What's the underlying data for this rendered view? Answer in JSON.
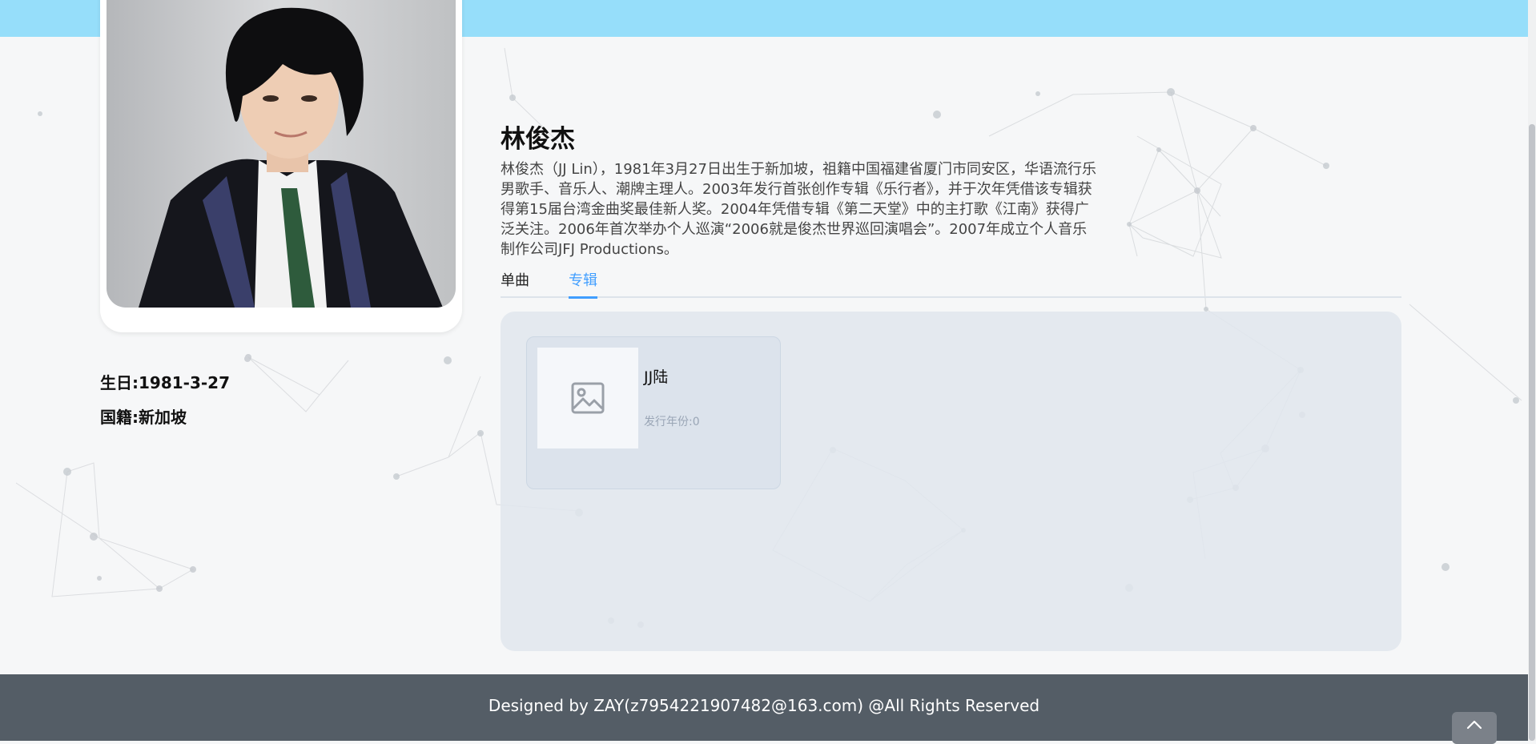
{
  "artist": {
    "name": "林俊杰",
    "bio": "林俊杰（JJ Lin），1981年3月27日出生于新加坡，祖籍中国福建省厦门市同安区，华语流行乐男歌手、音乐人、潮牌主理人。2003年发行首张创作专辑《乐行者》，并于次年凭借该专辑获得第15届台湾金曲奖最佳新人奖。2004年凭借专辑《第二天堂》中的主打歌《江南》获得广泛关注。2006年首次举办个人巡演“2006就是俊杰世界巡回演唱会”。2007年成立个人音乐制作公司JFJ Productions。",
    "birthday": "生日:1981-3-27",
    "nationality": "国籍:新加坡"
  },
  "tabs": [
    {
      "label": "单曲",
      "active": false
    },
    {
      "label": "专辑",
      "active": true
    }
  ],
  "albums": [
    {
      "title": "JJ陆",
      "year_label": "发行年份:0",
      "cover_icon": "image-placeholder-icon"
    }
  ],
  "footer": {
    "text": "Designed by ZAY(z7954221907482@163.com) @All Rights Reserved"
  },
  "colors": {
    "header": "#96defa",
    "accent": "#409eff",
    "footer": "#545d66"
  },
  "icons": {
    "back_to_top": "chevron-up-icon"
  }
}
